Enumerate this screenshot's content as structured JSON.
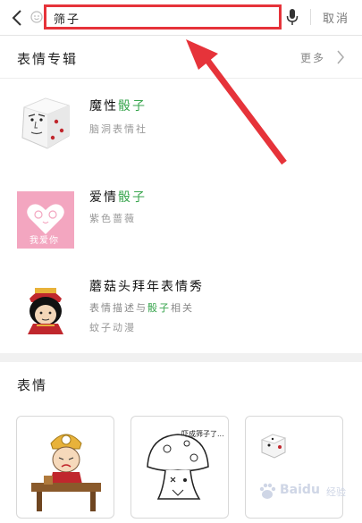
{
  "search": {
    "query": "筛子",
    "cancel_label": "取消"
  },
  "albums_section": {
    "title": "表情专辑",
    "more_label": "更多"
  },
  "albums": [
    {
      "name_prefix": "魔性",
      "name_highlight": "骰子",
      "subtitle": "脑洞表情社"
    },
    {
      "name_prefix": "爱情",
      "name_highlight": "骰子",
      "subtitle": "紫色蔷薇",
      "thumb_text": "我爱你"
    },
    {
      "name": "蘑菇头拜年表情秀",
      "desc_prefix": "表情描述与",
      "desc_highlight": "骰子",
      "desc_suffix": "相关",
      "subtitle": "蚊子动漫"
    }
  ],
  "stickers_section": {
    "title": "表情"
  },
  "stickers": [
    {
      "icon": "cartoon-character-desk"
    },
    {
      "icon": "mushroom-doodle",
      "caption": "吓成筛子了..."
    },
    {
      "icon": "dice"
    }
  ],
  "watermark": {
    "brand": "Baidu",
    "suffix": "经验"
  },
  "colors": {
    "highlight": "#3aa64f",
    "annotation_red": "#e6333a",
    "thumb_pink": "#f3a6c0"
  }
}
